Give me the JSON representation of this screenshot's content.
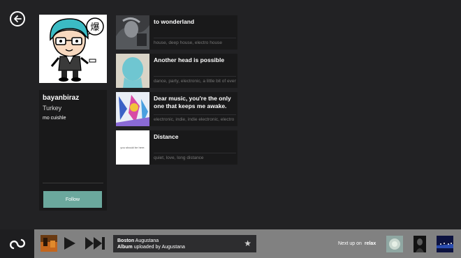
{
  "profile": {
    "username": "bayanbiraz",
    "country": "Turkey",
    "bio": "mo cuishle",
    "follow_label": "Follow",
    "avatar_glyph": "爆"
  },
  "tracks": [
    {
      "title": "to wonderland",
      "tags": "house, deep house, electro house"
    },
    {
      "title": "Another head is possible",
      "tags": "dance, party, electronic, a little bit of everything"
    },
    {
      "title": "Dear music, you're the only one that keeps me awake.",
      "tags": "electronic, indie, indie electronic, electro"
    },
    {
      "title": "Distance",
      "tags": "quiet, love, long distance",
      "thumb_text": "you should be here."
    }
  ],
  "player": {
    "song": "Boston",
    "artist": "Augustana",
    "album_label": "Album",
    "uploaded_text": "uploaded by Augustana",
    "next_up_label": "Next up on",
    "next_up_playlist": "relax"
  },
  "colors": {
    "background": "#222224",
    "panel": "#19191a",
    "accent": "#6ba89d",
    "player_bar": "#818181"
  },
  "icons": [
    "back-arrow-icon",
    "infinity-logo-icon",
    "play-icon",
    "skip-forward-icon",
    "star-icon"
  ]
}
